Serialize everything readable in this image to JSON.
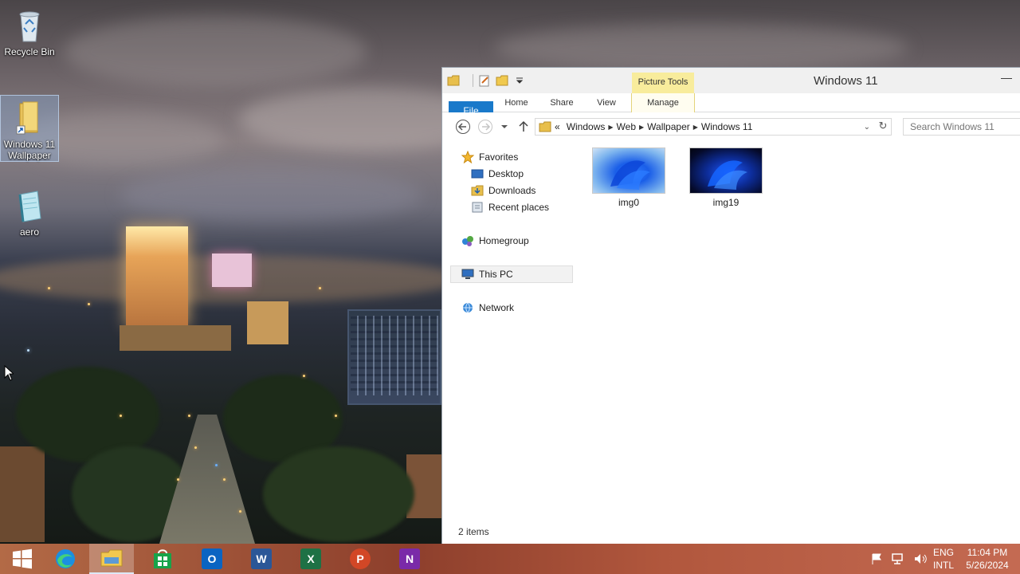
{
  "desktop": {
    "icons": [
      {
        "label": "Recycle Bin",
        "icon": "recycle-bin-icon"
      },
      {
        "label": "Windows 11 Wallpaper",
        "icon": "folder-shortcut-icon"
      },
      {
        "label": "aero",
        "icon": "theme-file-icon"
      }
    ]
  },
  "window": {
    "title": "Windows 11",
    "context_tab": "Picture Tools",
    "ribbon_tabs": [
      "File",
      "Home",
      "Share",
      "View",
      "Manage"
    ],
    "address": {
      "overflow": "«",
      "crumbs": [
        "Windows",
        "Web",
        "Wallpaper",
        "Windows 11"
      ]
    },
    "search_placeholder": "Search Windows 11",
    "nav": {
      "favorites": "Favorites",
      "desktop": "Desktop",
      "downloads": "Downloads",
      "recent": "Recent places",
      "homegroup": "Homegroup",
      "thispc": "This PC",
      "network": "Network"
    },
    "files": [
      {
        "name": "img0"
      },
      {
        "name": "img19"
      }
    ],
    "status": "2 items"
  },
  "taskbar": {
    "apps": [
      {
        "name": "start",
        "icon": "windows-logo-icon"
      },
      {
        "name": "edge",
        "icon": "edge-icon"
      },
      {
        "name": "file-explorer",
        "icon": "folder-icon",
        "active": true
      },
      {
        "name": "store",
        "icon": "store-icon"
      },
      {
        "name": "outlook",
        "letter": "O",
        "color": "#0a64c2"
      },
      {
        "name": "word",
        "letter": "W",
        "color": "#2b5797"
      },
      {
        "name": "excel",
        "letter": "X",
        "color": "#1e7145"
      },
      {
        "name": "powerpoint",
        "letter": "P",
        "color": "#d24726"
      },
      {
        "name": "onenote",
        "letter": "N",
        "color": "#7a2aa8"
      }
    ],
    "language": {
      "line1": "ENG",
      "line2": "INTL"
    },
    "clock": {
      "time": "11:04 PM",
      "date": "5/26/2024"
    }
  },
  "colors": {
    "accent": "#1979ca",
    "context_tab": "#f8ec9c",
    "taskbar": "#a44f37"
  }
}
